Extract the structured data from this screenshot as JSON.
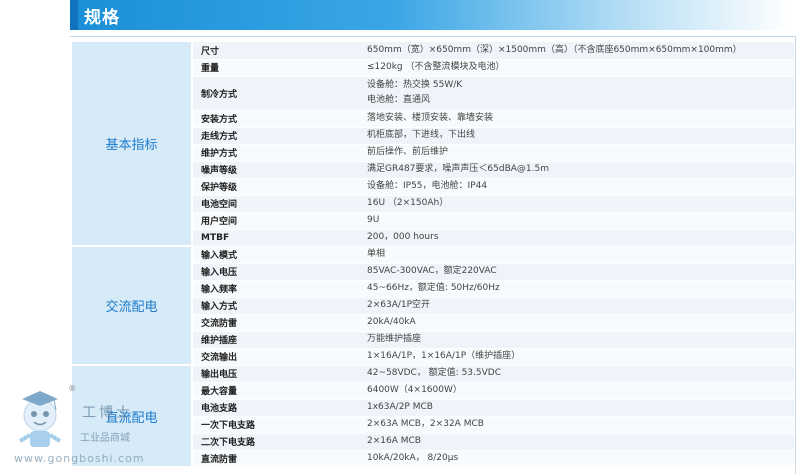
{
  "header": {
    "title": "规格"
  },
  "sections": [
    {
      "category": "基本指标",
      "rows": [
        {
          "label": "尺寸",
          "values": [
            "650mm（宽）×650mm（深）×1500mm（高）（不含底座650mm×650mm×100mm）"
          ]
        },
        {
          "label": "重量",
          "values": [
            "≤120kg （不含整流模块及电池）"
          ]
        },
        {
          "label": "制冷方式",
          "values": [
            "设备舱：热交换 55W/K",
            "电池舱：直通风"
          ]
        },
        {
          "label": "安装方式",
          "values": [
            "落地安装、楼顶安装、靠墙安装"
          ]
        },
        {
          "label": "走线方式",
          "values": [
            "机柜底部，下进线，下出线"
          ]
        },
        {
          "label": "维护方式",
          "values": [
            "前后操作、前后维护"
          ]
        },
        {
          "label": "噪声等级",
          "values": [
            "满足GR487要求，噪声声压＜65dBA@1.5m"
          ]
        },
        {
          "label": "保护等级",
          "values": [
            "设备舱：IP55，电池舱：IP44"
          ]
        },
        {
          "label": "电池空间",
          "values": [
            "16U （2×150Ah）"
          ]
        },
        {
          "label": "用户空间",
          "values": [
            "9U"
          ]
        },
        {
          "label": "MTBF",
          "values": [
            "200，000 hours"
          ]
        }
      ]
    },
    {
      "category": "交流配电",
      "rows": [
        {
          "label": "输入模式",
          "values": [
            "单相"
          ]
        },
        {
          "label": "输入电压",
          "values": [
            "85VAC-300VAC，额定220VAC"
          ]
        },
        {
          "label": "输入频率",
          "values": [
            "45~66Hz，额定值: 50Hz/60Hz"
          ]
        },
        {
          "label": "输入方式",
          "values": [
            "2×63A/1P空开"
          ]
        },
        {
          "label": "交流防雷",
          "values": [
            "20kA/40kA"
          ]
        },
        {
          "label": "维护插座",
          "values": [
            "万能维护插座"
          ]
        },
        {
          "label": "交流输出",
          "values": [
            "1×16A/1P，1×16A/1P（维护插座）"
          ]
        }
      ]
    },
    {
      "category": "直流配电",
      "rows": [
        {
          "label": "输出电压",
          "values": [
            "42~58VDC， 额定值: 53.5VDC"
          ]
        },
        {
          "label": "最大容量",
          "values": [
            "6400W（4×1600W）"
          ]
        },
        {
          "label": "电池支路",
          "values": [
            "1x63A/2P MCB"
          ]
        },
        {
          "label": "一次下电支路",
          "values": [
            "2×63A MCB，2×32A MCB"
          ]
        },
        {
          "label": "二次下电支路",
          "values": [
            "2×16A MCB"
          ]
        },
        {
          "label": "直流防雷",
          "values": [
            "10kA/20kA， 8/20μs"
          ]
        }
      ]
    }
  ],
  "watermark": {
    "brand": "工博士",
    "registered": "®",
    "subtitle": "工业品商城",
    "url": "www.gongboshi.com"
  }
}
